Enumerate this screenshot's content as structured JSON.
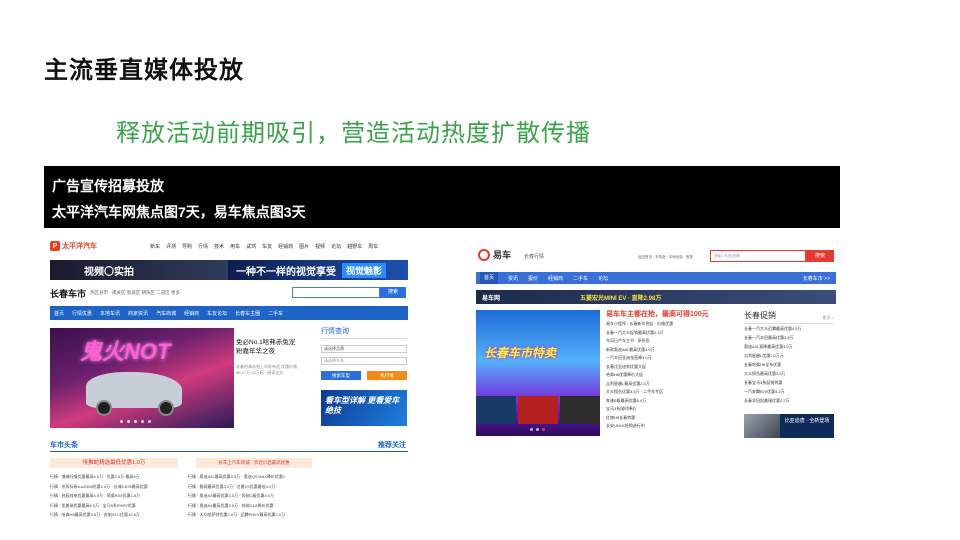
{
  "slide": {
    "title": "主流垂直媒体投放",
    "subtitle": "释放活动前期吸引，营造活动热度扩散传播",
    "bar_line1": "广告宣传招募投放",
    "bar_line2": "太平洋汽车网焦点图7天，易车焦点图3天"
  },
  "left_site": {
    "logo_mark": "P",
    "logo_text": "太平洋汽车",
    "nav": [
      "新车",
      "评测",
      "导购",
      "行情",
      "技术",
      "用车",
      "试驾",
      "车友",
      "经销商",
      "图片",
      "视频",
      "论坛",
      "越野车",
      "周车"
    ],
    "ad1_text": "视频〇实拍",
    "ad2_text": "一种不一样的视觉享受",
    "ad2_tag": "视觉魅影",
    "city": "长春车市",
    "city_sub": "热区县市 · 南关区 宽城区 朝阳区 二道区 更多",
    "search_btn": "搜索",
    "bluenav": [
      "首页",
      "行情优惠",
      "本地车讯",
      "商家资讯",
      "汽车商城",
      "经销商",
      "车友论坛",
      "长春车主圈",
      "二手车"
    ],
    "hero_neon": "鬼火NOT",
    "hero_title": "免必No.1哈弗赤兔宠粉嘉年华之夜",
    "hero_sub": "长春哈弗赤兔上市发布会 优惠价格 ¥8.67万-10万起 · 阅读全文",
    "price_title": "行情查询",
    "price_sel1": "请选择品牌",
    "price_sel2": "请选择车系",
    "price_btn1": "搜索车型",
    "price_btn2": "找行情",
    "small_ad": "看车型详解 更看爱车绝技",
    "headline_left": "车市头条",
    "headline_right": "推荐关注",
    "banner1": "埃推蛇精选最低优惠1.0万",
    "banner2": "长车上汽车商城 · 享近价后最高优惠",
    "list_left": [
      "行情 · 博瑞行情优惠最高4.0万 · 优惠2.5万 最高5万",
      "行情 · 东风标致suv2008优惠2.5万 · 长城CE95最高优惠",
      "行情 · 启辰纯电优惠最高4.0万 · 荣威RX5优惠1.8万",
      "行情 · 凯美瑞优惠最高6.0万 · 宝马5系PHEV优惠",
      "行情 · 哈弗H6最高优惠3.5万 · 奔驰GLC优惠10.6万"
    ],
    "list_right": [
      "行情 · 奥迪A4L最高优惠3.5万 · 奥迪Q5 MAX降价优惠1",
      "行情 · 雅阁最高优惠3.2万 · 名爵ZS优惠最低4.0万",
      "行情 · 奥迪A3最高优惠3.5万 · 奔驰C级优惠4.0万",
      "行情 · 奥迪A4最高优惠3.5万 · 奔驰GLA降价优惠",
      "行情 · 大众帕萨特优惠2.0万 · 迈腾PHEV最高优惠2.5万"
    ]
  },
  "right_site": {
    "logo_text": "易车",
    "city_sel": "长春行情",
    "links": "返回首页 · 手机版 · 本地优惠 · 登录",
    "search_placeholder": "请输入车型/品牌",
    "search_btn": "搜索",
    "nav": [
      "首页",
      "资讯",
      "报价",
      "经销商",
      "二手车",
      "论坛"
    ],
    "nav_right": "长春车市 >>",
    "ad_left": "易车网",
    "ad_mid": "五菱宏光MINI EV · 直降2.98万",
    "hero_tag": "长春车市特卖",
    "mid_headline": "易车车主都在抢，最高可得100元",
    "mid_rows": [
      "易车小程序 · 长春新车到店 · 价格优惠",
      "长春一汽大众促销最高优惠2.5万",
      "东风日产车主节 · 享折扣",
      "新款奥迪A6L最高优惠4.0万",
      "一汽丰田亚洲龙直降3.0万",
      "长春比亚迪宋优惠大促",
      "哈弗H6优惠降价大促",
      "吉利星越L最高优惠2.0万",
      "大众探岳优惠3.5万 · 二手车专区",
      "奔驰E级最高优惠6.0万",
      "宝马3系限时降价",
      "红旗H5长春特惠",
      "长安UNI-K抢购进行中"
    ],
    "right_title": "长春促销",
    "right_more": "更多 >",
    "right_rows": [
      "长春一汽大众迈腾最高优惠4.5万",
      "长春一汽丰田最高优惠3.8万",
      "奥迪A4L直降最高优惠4.0万",
      "吉利星越L优惠2.0万元",
      "长春哈弗H6全系优惠",
      "大众探岳最高优惠3.5万",
      "长春宝马3系促销特惠",
      "一汽奔腾B70优惠4.2万",
      "长春丰田凯美瑞优惠2.2万"
    ],
    "minead_text": "比亚迪唐 · 全新登场"
  }
}
